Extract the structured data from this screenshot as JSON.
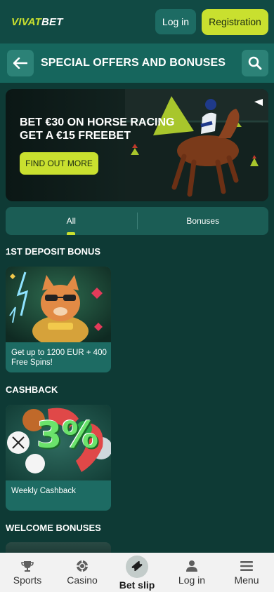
{
  "header": {
    "logo_vivat": "VIVAT",
    "logo_bet": "BET",
    "login_label": "Log in",
    "registration_label": "Registration"
  },
  "titlebar": {
    "title": "SPECIAL OFFERS AND BONUSES"
  },
  "promo": {
    "title": "BET €30 ON HORSE RACING\nGET A €15 FREEBET",
    "cta": "FIND OUT MORE"
  },
  "tabs": [
    {
      "label": "All",
      "active": true
    },
    {
      "label": "Bonuses",
      "active": false
    }
  ],
  "sections": [
    {
      "title": "1ST DEPOSIT BONUS",
      "card_text": "Get up to 1200 EUR + 400 Free Spins!"
    },
    {
      "title": "CASHBACK",
      "card_text": "Weekly Cashback"
    },
    {
      "title": "WELCOME BONUSES"
    }
  ],
  "cashback_badge": "3%",
  "bottom_nav": [
    {
      "label": "Sports",
      "icon": "trophy-icon"
    },
    {
      "label": "Casino",
      "icon": "chip-icon"
    },
    {
      "label": "Bet slip",
      "icon": "ticket-icon"
    },
    {
      "label": "Log in",
      "icon": "user-icon"
    },
    {
      "label": "Menu",
      "icon": "menu-icon"
    }
  ],
  "colors": {
    "accent": "#c9e02f",
    "background": "#0e3a35",
    "header": "#114a44",
    "titlebar": "#16665d",
    "card": "#1d6b63"
  }
}
